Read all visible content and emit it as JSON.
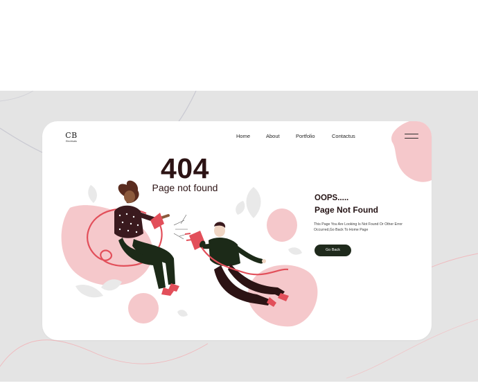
{
  "logo": {
    "mark": "CB",
    "subtitle": "Electricals"
  },
  "nav": [
    {
      "label": "Home"
    },
    {
      "label": "About"
    },
    {
      "label": "Portfolio"
    },
    {
      "label": "Contactus"
    }
  ],
  "error": {
    "code": "404",
    "subtitle": "Page not found"
  },
  "message": {
    "heading": "OOPS.....",
    "title": "Page Not Found",
    "line1": "This Page You Are Looking Is Not Found Or Other Error",
    "line2": "Occurred,Go Back To Home Page"
  },
  "button": {
    "label": "Go Back"
  },
  "colors": {
    "background": "#e4e4e4",
    "card": "#ffffff",
    "blob_pink": "#f5c8cb",
    "accent_red": "#e24f5a",
    "button_dark": "#1f2a1c",
    "heading_dark": "#2c1314"
  },
  "icons": [
    "menu-icon",
    "plug-icon",
    "leaf-icon"
  ]
}
